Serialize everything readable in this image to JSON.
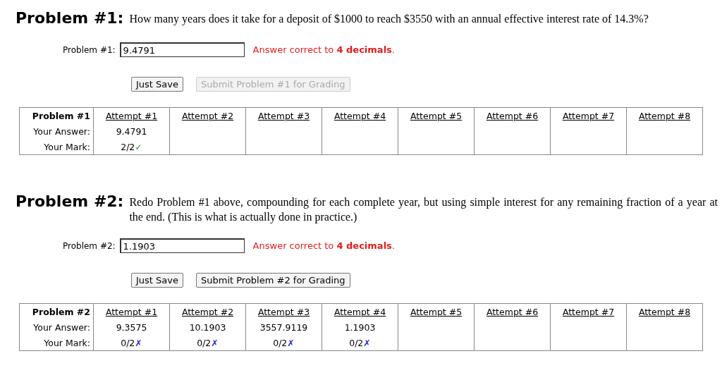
{
  "problems": [
    {
      "title": "Problem #1:",
      "question": "How many years does it take for a deposit of $1000 to reach $3550 with an annual effective interest rate of 14.3%?",
      "answer_label": "Problem #1:",
      "answer_value": "9.4791",
      "hint": "Answer correct to **4 decimals**.",
      "buttons": [
        {
          "label": "Just Save",
          "disabled": false
        },
        {
          "label": "Submit Problem #1 for Grading",
          "disabled": true
        }
      ],
      "table": {
        "heading": "Problem #1",
        "answer_label": "Your Answer:",
        "mark_label": "Your Mark:",
        "attempts": [
          {
            "label": "Attempt #1",
            "answer": "9.4791",
            "mark": "2/2",
            "symbol": "✓",
            "kind": "correct"
          },
          {
            "label": "Attempt #2"
          },
          {
            "label": "Attempt #3"
          },
          {
            "label": "Attempt #4"
          },
          {
            "label": "Attempt #5"
          },
          {
            "label": "Attempt #6"
          },
          {
            "label": "Attempt #7"
          },
          {
            "label": "Attempt #8"
          }
        ]
      }
    },
    {
      "title": "Problem #2:",
      "question": "Redo Problem #1 above, compounding for each complete year, but using simple interest for any remaining fraction of a year at the end. (This is what is actually done in practice.)",
      "answer_label": "Problem #2:",
      "answer_value": "1.1903",
      "hint": "Answer correct to **4 decimals**.",
      "buttons": [
        {
          "label": "Just Save",
          "disabled": false
        },
        {
          "label": "Submit Problem #2 for Grading",
          "disabled": false
        }
      ],
      "table": {
        "heading": "Problem #2",
        "answer_label": "Your Answer:",
        "mark_label": "Your Mark:",
        "attempts": [
          {
            "label": "Attempt #1",
            "answer": "9.3575",
            "mark": "0/2",
            "symbol": "✗",
            "kind": "wrong"
          },
          {
            "label": "Attempt #2",
            "answer": "10.1903",
            "mark": "0/2",
            "symbol": "✗",
            "kind": "wrong"
          },
          {
            "label": "Attempt #3",
            "answer": "3557.9119",
            "mark": "0/2",
            "symbol": "✗",
            "kind": "wrong"
          },
          {
            "label": "Attempt #4",
            "answer": "1.1903",
            "mark": "0/2",
            "symbol": "✗",
            "kind": "wrong"
          },
          {
            "label": "Attempt #5"
          },
          {
            "label": "Attempt #6"
          },
          {
            "label": "Attempt #7"
          },
          {
            "label": "Attempt #8"
          }
        ]
      }
    }
  ]
}
